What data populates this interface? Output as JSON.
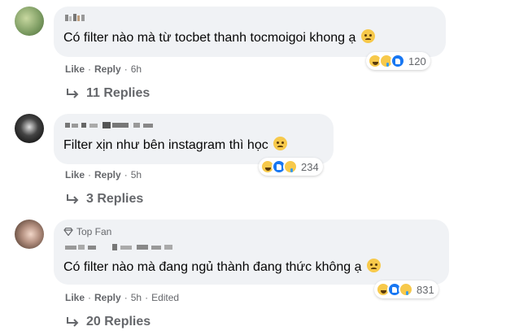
{
  "comments": [
    {
      "author_badge": "",
      "text": "Có filter nào mà từ tocbet thanh tocmoigoi khong ạ",
      "actions": {
        "like": "Like",
        "reply": "Reply",
        "time": "6h",
        "edited": ""
      },
      "reaction_count": "120",
      "replies_label": "11 Replies"
    },
    {
      "author_badge": "",
      "text": "Filter xịn như bên instagram thì học",
      "actions": {
        "like": "Like",
        "reply": "Reply",
        "time": "5h",
        "edited": ""
      },
      "reaction_count": "234",
      "replies_label": "3 Replies"
    },
    {
      "author_badge": "Top Fan",
      "text": "Có filter nào mà đang ngủ thành đang thức không ạ",
      "actions": {
        "like": "Like",
        "reply": "Reply",
        "time": "5h",
        "edited": "Edited"
      },
      "reaction_count": "831",
      "replies_label": "20 Replies"
    }
  ],
  "separator": "·",
  "colors": {
    "bubble": "#f0f2f5",
    "secondary_text": "#65676b",
    "like_blue": "#1877f2",
    "emoji_yellow": "#f7c94b"
  }
}
